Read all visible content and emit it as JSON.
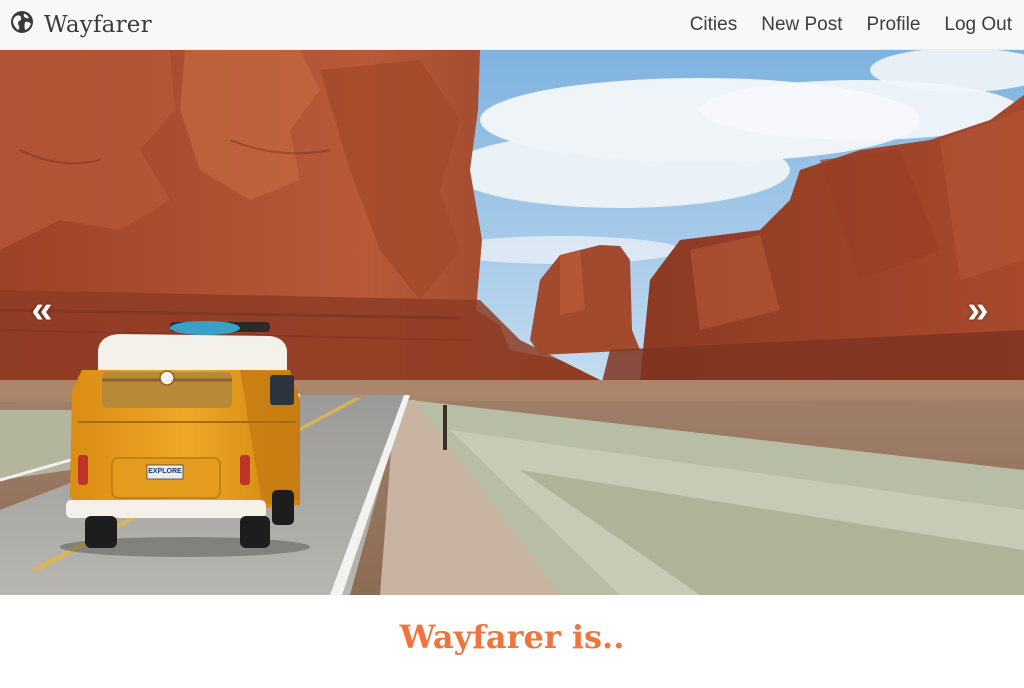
{
  "navbar": {
    "brand_icon": "globe-icon",
    "brand_name": "Wayfarer",
    "links": [
      "Cities",
      "New Post",
      "Profile",
      "Log Out"
    ]
  },
  "carousel": {
    "prev_icon": "double-chevron-left-icon",
    "next_icon": "double-chevron-right-icon",
    "prev_glyph": "«",
    "next_glyph": "»",
    "van_plate": "EXPLORE"
  },
  "main": {
    "tagline": "Wayfarer is.."
  },
  "colors": {
    "accent": "#f07440",
    "navbar_bg": "#f8f8f8",
    "rock": "#a84a2e",
    "sky": "#9cc8e6",
    "van": "#e9a21f"
  }
}
